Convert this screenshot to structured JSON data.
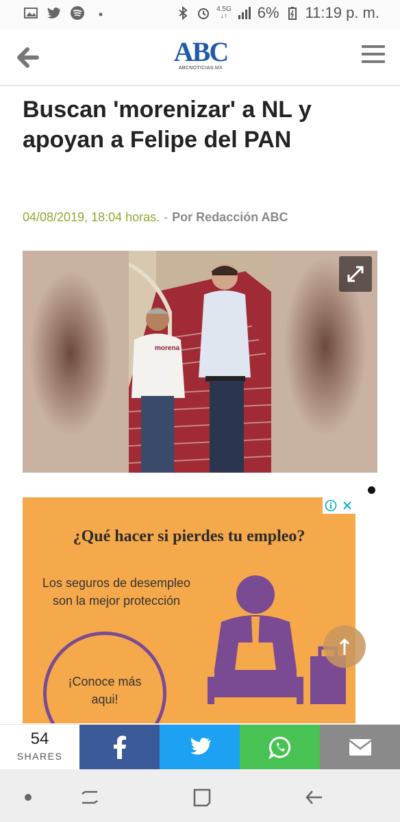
{
  "status_bar": {
    "left_icons": [
      "image-icon",
      "twitter-icon",
      "spotify-icon",
      "dot-icon"
    ],
    "right_icons": [
      "bluetooth-icon",
      "alarm-icon",
      "network-icon",
      "signal-icon",
      "battery-icon"
    ],
    "network_label": "4.5G",
    "battery": "6%",
    "time": "11:19 p. m."
  },
  "header": {
    "logo_main": "ABC",
    "logo_sub": "ABCNOTICIAS.MX",
    "back_icon": "arrow-left-icon",
    "menu_icon": "hamburger-menu-icon"
  },
  "article": {
    "title": "Buscan 'morenizar' a NL y apoyan a Felipe del PAN",
    "date": "04/08/2019, 18:04 horas.",
    "separator": "-",
    "author": "Por Redacción ABC",
    "photo_badge": "morena",
    "expand_icon": "expand-icon"
  },
  "ad": {
    "headline": "¿Qué hacer si pierdes tu empleo?",
    "subline": "Los seguros de desempleo son la mejor protección",
    "cta": "¡Conoce más aqui!",
    "info_icon": "info-icon",
    "close_icon": "close-icon",
    "colors": {
      "background": "#f6a94a",
      "accent": "#7a4a92"
    }
  },
  "scroll_top_icon": "arrow-up-icon",
  "share_bar": {
    "count": "54",
    "label": "SHARES",
    "buttons": [
      {
        "name": "facebook",
        "icon": "facebook-icon",
        "color": "#3b5a9a"
      },
      {
        "name": "twitter",
        "icon": "twitter-icon",
        "color": "#1da1f2"
      },
      {
        "name": "whatsapp",
        "icon": "whatsapp-icon",
        "color": "#47c253"
      },
      {
        "name": "email",
        "icon": "envelope-icon",
        "color": "#8a8a8a"
      }
    ]
  },
  "nav_bar": {
    "items": [
      "dot-icon",
      "recents-icon",
      "home-icon",
      "back-icon"
    ]
  }
}
